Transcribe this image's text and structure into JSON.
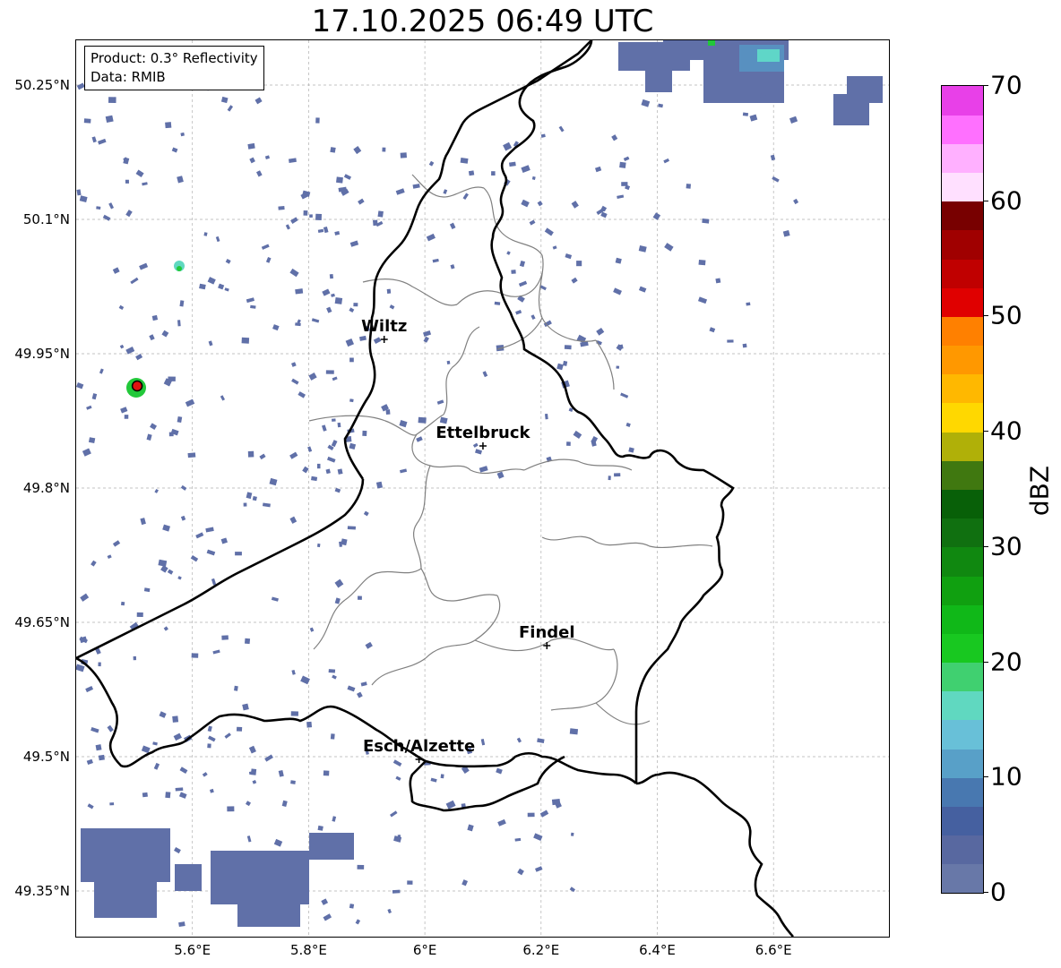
{
  "title": "17.10.2025 06:49 UTC",
  "info": {
    "product": "Product: 0.3° Reflectivity",
    "data": "Data: RMIB"
  },
  "map": {
    "lon_range": [
      5.4,
      6.8
    ],
    "lat_range": [
      49.3,
      50.3
    ],
    "lat_ticks": [
      {
        "value": 50.25,
        "label": "50.25°N"
      },
      {
        "value": 50.1,
        "label": "50.1°N"
      },
      {
        "value": 49.95,
        "label": "49.95°N"
      },
      {
        "value": 49.8,
        "label": "49.8°N"
      },
      {
        "value": 49.65,
        "label": "49.65°N"
      },
      {
        "value": 49.5,
        "label": "49.5°N"
      },
      {
        "value": 49.35,
        "label": "49.35°N"
      }
    ],
    "lon_ticks": [
      {
        "value": 5.6,
        "label": "5.6°E"
      },
      {
        "value": 5.8,
        "label": "5.8°E"
      },
      {
        "value": 6.0,
        "label": "6°E"
      },
      {
        "value": 6.2,
        "label": "6.2°E"
      },
      {
        "value": 6.4,
        "label": "6.4°E"
      },
      {
        "value": 6.6,
        "label": "6.6°E"
      }
    ],
    "grid": true,
    "cities": [
      {
        "name": "Wiltz",
        "lon": 5.93,
        "lat": 49.966
      },
      {
        "name": "Ettelbruck",
        "lon": 6.1,
        "lat": 49.847
      },
      {
        "name": "Findel",
        "lon": 6.21,
        "lat": 49.624
      },
      {
        "name": "Esch/Alzette",
        "lon": 5.99,
        "lat": 49.497
      }
    ],
    "radar_marker": {
      "lon": 5.505,
      "lat": 49.914,
      "color": "#e01010"
    },
    "colors": {
      "border": "#000000",
      "cantons": "#808080",
      "grid": "#b0b0b0",
      "echo_weak": "#6070a8",
      "echo_mid": "#5fd6c8",
      "echo_green": "#22c83a"
    }
  },
  "colorbar": {
    "label": "dBZ",
    "min": 0,
    "max": 70,
    "ticks": [
      "0",
      "10",
      "20",
      "30",
      "40",
      "50",
      "60",
      "70"
    ],
    "colors": [
      "#6878a8",
      "#5868a0",
      "#4560a0",
      "#4878b0",
      "#58a0c8",
      "#68c0d8",
      "#60d8c0",
      "#40d070",
      "#18c820",
      "#10b818",
      "#10a010",
      "#108810",
      "#107010",
      "#086008",
      "#407810",
      "#b0b008",
      "#ffd800",
      "#ffb800",
      "#ff9800",
      "#ff8000",
      "#e00000",
      "#c00000",
      "#a00000",
      "#780000",
      "#ffe0ff",
      "#ffb0ff",
      "#ff70ff",
      "#e840e8"
    ]
  }
}
